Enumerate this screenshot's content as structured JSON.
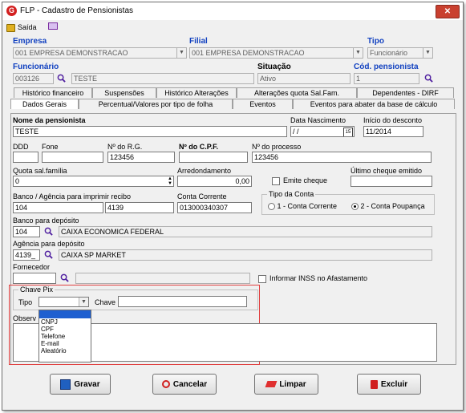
{
  "window": {
    "title": "FLP - Cadastro de Pensionistas"
  },
  "menu": {
    "exit_label": "Saída"
  },
  "header": {
    "empresa_label": "Empresa",
    "empresa_value": "001 EMPRESA DEMONSTRACAO",
    "filial_label": "Filial",
    "filial_value": "001 EMPRESA DEMONSTRACAO",
    "tipo_label": "Tipo",
    "tipo_value": "Funcionário",
    "funcionario_label": "Funcionário",
    "funcionario_code": "003126",
    "funcionario_name": "TESTE",
    "situacao_label": "Situação",
    "situacao_value": "Ativo",
    "cod_pens_label": "Cód. pensionista",
    "cod_pens_value": "1"
  },
  "tabs": {
    "row1": [
      "Histórico financeiro",
      "Suspensões",
      "Histórico Alterações",
      "Alterações quota Sal.Fam.",
      "Dependentes - DIRF"
    ],
    "row2": [
      "Dados Gerais",
      "Percentual/Valores por tipo de folha",
      "Eventos",
      "Eventos para abater da base de cálculo"
    ]
  },
  "form": {
    "nome_label": "Nome da pensionista",
    "nome_value": "TESTE",
    "nasc_label": "Data Nascimento",
    "nasc_value": "/ /",
    "cal_icon": "15",
    "inicio_label": "Início do desconto",
    "inicio_value": "11/2014",
    "ddd_label": "DDD",
    "fone_label": "Fone",
    "rg_label": "Nº do R.G.",
    "rg_value": "123456",
    "cpf_label": "Nº do C.P.F.",
    "processo_label": "Nº do processo",
    "processo_value": "123456",
    "quota_label": "Quota sal.família",
    "quota_value": "0",
    "arred_label": "Arredondamento",
    "arred_value": "0,00",
    "emite_label": "Emite cheque",
    "ultimo_label": "Último cheque emitido",
    "banco_label": "Banco / Agência para imprimir recibo",
    "banco_value": "104",
    "agencia_value": "4139",
    "conta_label": "Conta Corrente",
    "conta_value": "013000340307",
    "tipo_conta_label": "Tipo da Conta",
    "tipo_conta_opt1": "1 - Conta Corrente",
    "tipo_conta_opt2": "2 - Conta Poupança",
    "banco_dep_label": "Banco para depósito",
    "banco_dep_code": "104",
    "banco_dep_name": "CAIXA ECONOMICA FEDERAL",
    "agencia_dep_label": "Agência para depósito",
    "agencia_dep_code": "4139_",
    "agencia_dep_name": "CAIXA SP MARKET",
    "fornecedor_label": "Fornecedor",
    "inss_label": "Informar INSS no Afastamento",
    "pix_label": "Chave Pix",
    "pix_tipo_label": "Tipo",
    "pix_chave_label": "Chave",
    "pix_options": [
      "CNPJ",
      "CPF",
      "Telefone",
      "E-mail",
      "Aleatório"
    ],
    "obs_label": "Observ"
  },
  "buttons": {
    "gravar": "Gravar",
    "cancelar": "Cancelar",
    "limpar": "Limpar",
    "excluir": "Excluir"
  }
}
